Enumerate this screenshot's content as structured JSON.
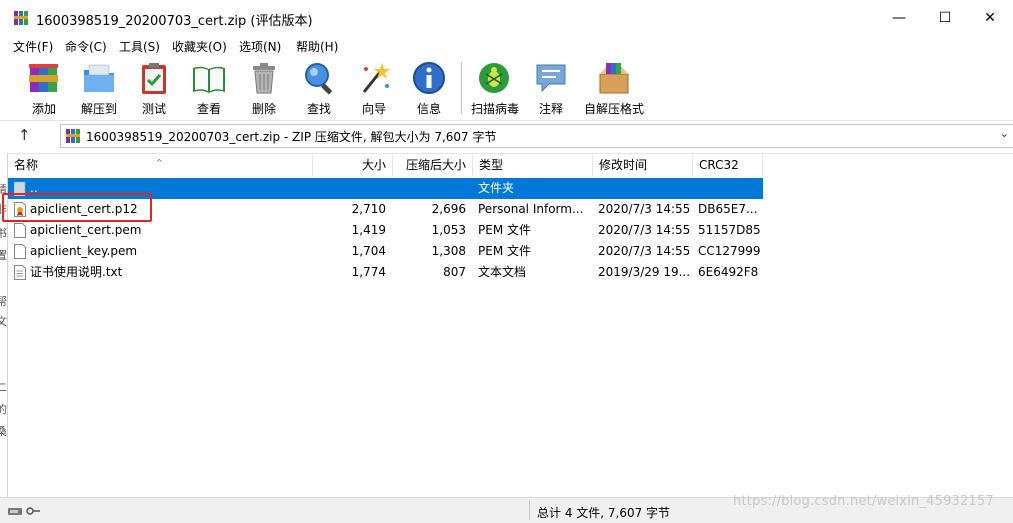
{
  "window": {
    "title": "1600398519_20200703_cert.zip (评估版本)",
    "minimize": "—",
    "maximize": "☐",
    "close": "✕"
  },
  "menu": [
    "文件(F)",
    "命令(C)",
    "工具(S)",
    "收藏夹(O)",
    "选项(N)",
    "帮助(H)"
  ],
  "toolbar": [
    "添加",
    "解压到",
    "测试",
    "查看",
    "删除",
    "查找",
    "向导",
    "信息",
    "扫描病毒",
    "注释",
    "自解压格式"
  ],
  "address": {
    "text": "1600398519_20200703_cert.zip - ZIP 压缩文件, 解包大小为 7,607 字节"
  },
  "columns": {
    "name": "名称",
    "size": "大小",
    "packed": "压缩后大小",
    "type": "类型",
    "modified": "修改时间",
    "crc": "CRC32"
  },
  "rows": [
    {
      "name": "..",
      "size": "",
      "packed": "",
      "type": "文件夹",
      "modified": "",
      "crc": ""
    },
    {
      "name": "apiclient_cert.p12",
      "size": "2,710",
      "packed": "2,696",
      "type": "Personal Inform...",
      "modified": "2020/7/3 14:55",
      "crc": "DB65E7..."
    },
    {
      "name": "apiclient_cert.pem",
      "size": "1,419",
      "packed": "1,053",
      "type": "PEM 文件",
      "modified": "2020/7/3 14:55",
      "crc": "51157D85"
    },
    {
      "name": "apiclient_key.pem",
      "size": "1,704",
      "packed": "1,308",
      "type": "PEM 文件",
      "modified": "2020/7/3 14:55",
      "crc": "CC127999"
    },
    {
      "name": "证书使用说明.txt",
      "size": "1,774",
      "packed": "807",
      "type": "文本文档",
      "modified": "2019/3/29 19...",
      "crc": "6E6492F8"
    }
  ],
  "status": {
    "text": "总计 4 文件, 7,607 字节"
  },
  "watermark": "https://blog.csdn.net/weixin_45932157",
  "left_strip": [
    "请",
    "非",
    "书",
    "置",
    "帮",
    "文",
    "二",
    "的",
    "桑"
  ]
}
